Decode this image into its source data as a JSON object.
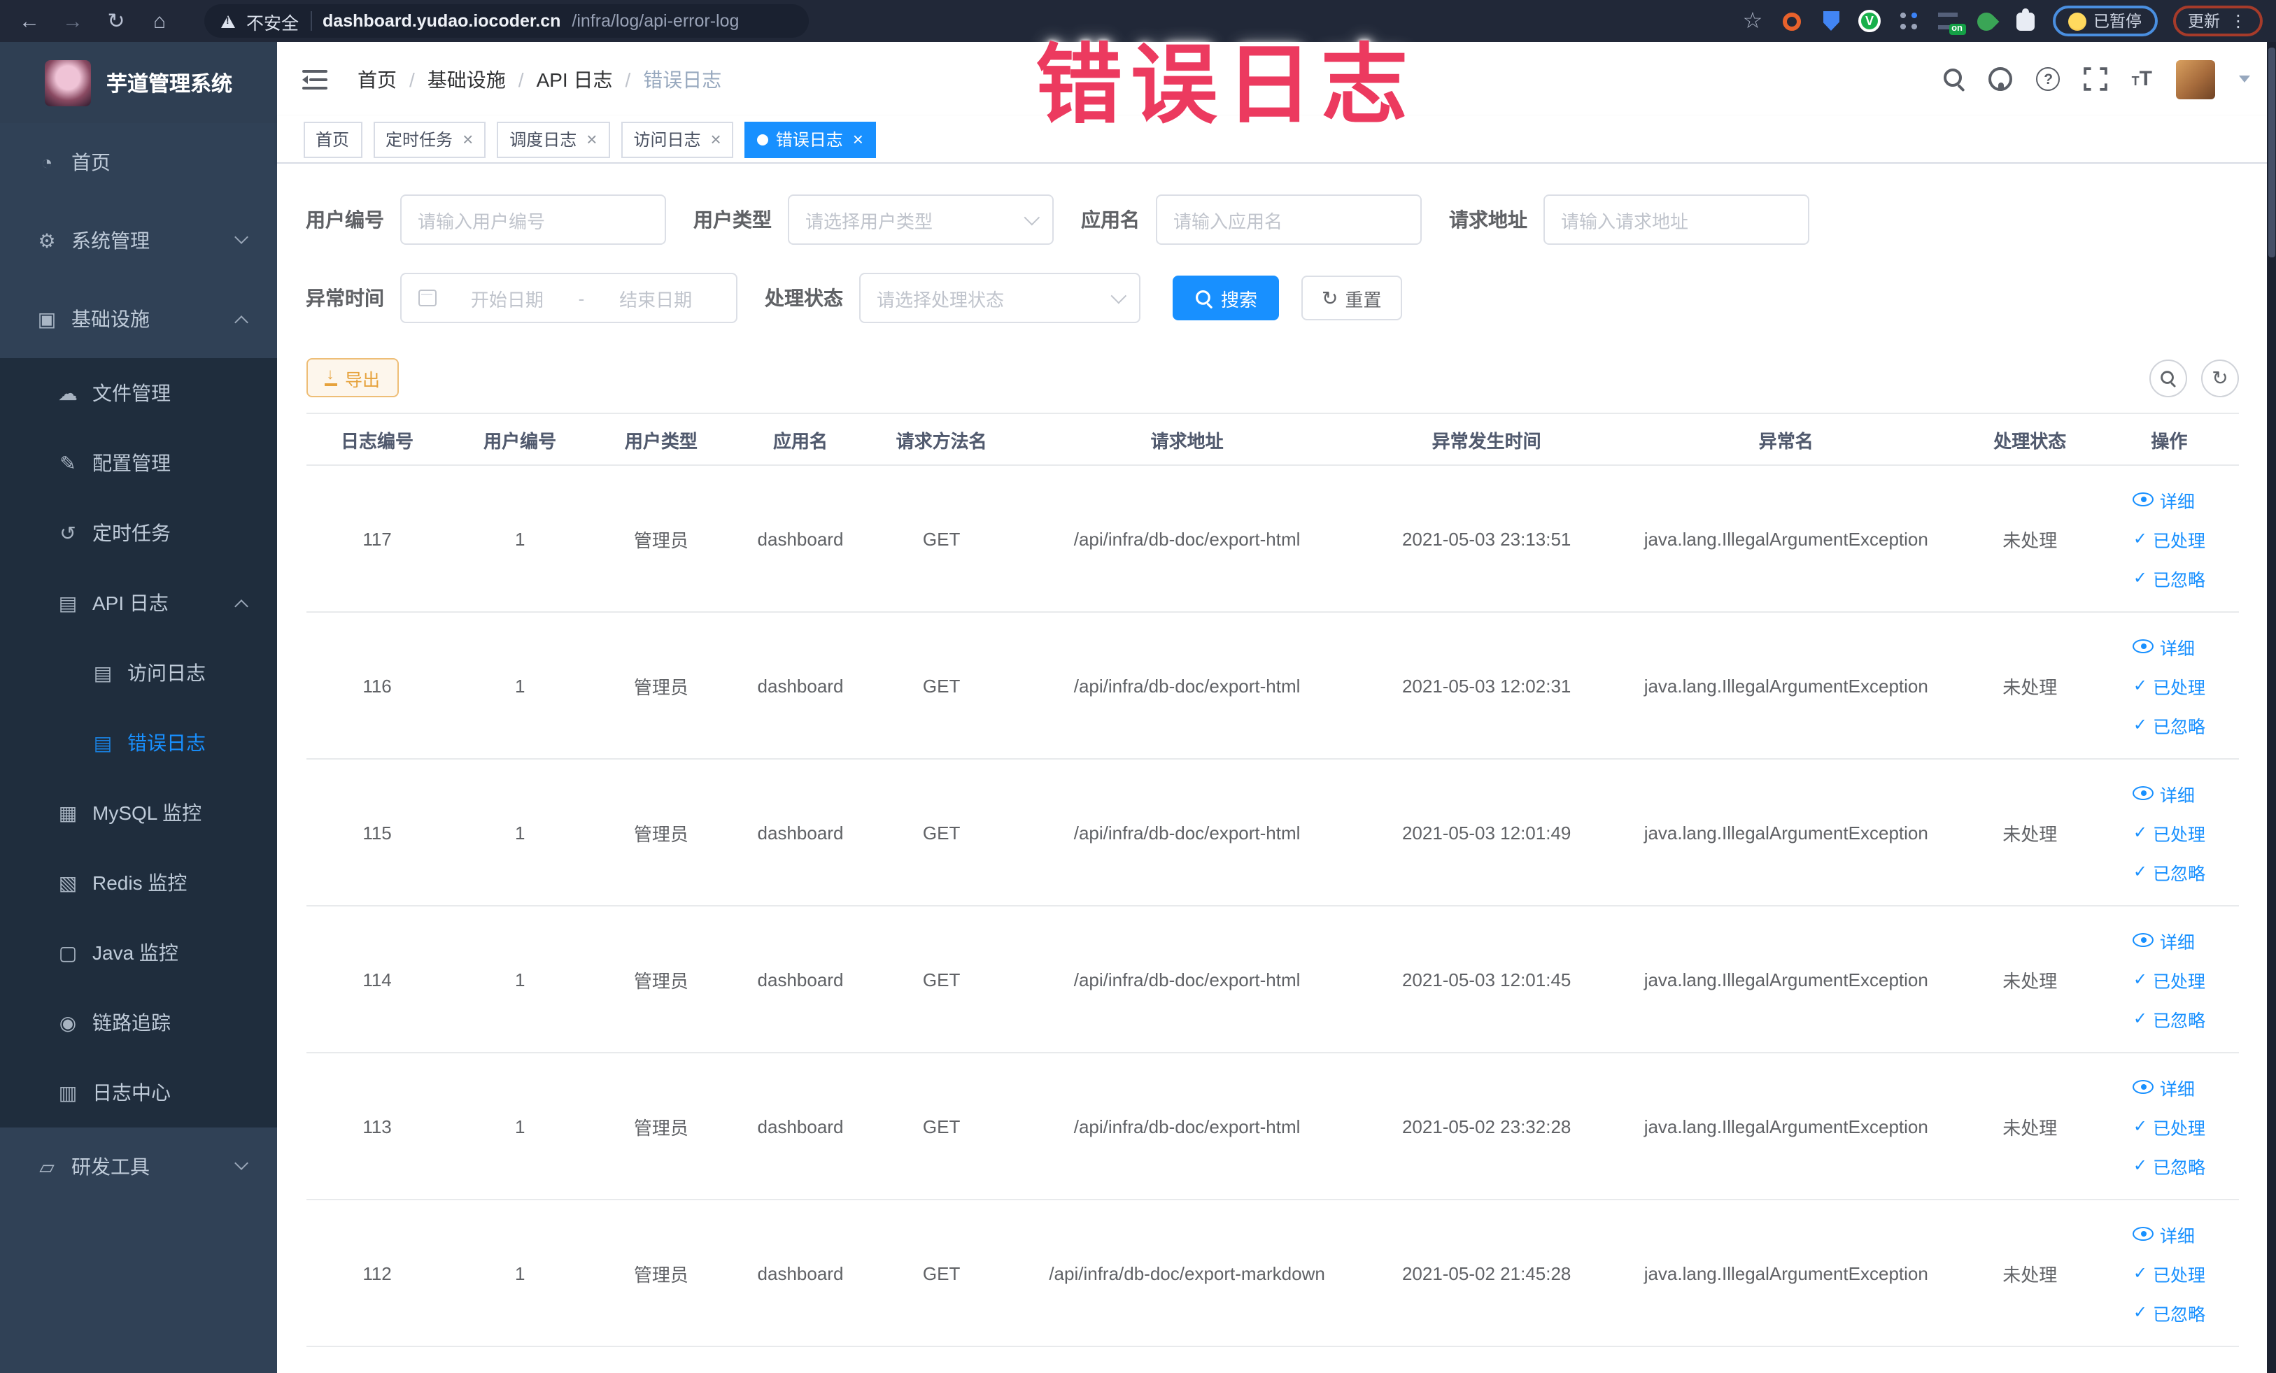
{
  "browser": {
    "security_label": "不安全",
    "url_domain": "dashboard.yudao.iocoder.cn",
    "url_path": "/infra/log/api-error-log",
    "paused_badge": "已暂停",
    "update_label": "更新",
    "extension_on_label": "on"
  },
  "annotation": {
    "text": "错误日志"
  },
  "sidebar": {
    "title": "芋道管理系统",
    "items": [
      {
        "id": "home",
        "label": "首页",
        "level": 1,
        "icon": "dashboard-icon"
      },
      {
        "id": "system",
        "label": "系统管理",
        "level": 1,
        "icon": "gear-icon",
        "chevron": "down"
      },
      {
        "id": "infra",
        "label": "基础设施",
        "level": 1,
        "icon": "monitor-icon",
        "chevron": "up"
      },
      {
        "id": "file-manage",
        "label": "文件管理",
        "level": 2,
        "icon": "cloud-icon",
        "sub": true
      },
      {
        "id": "config-manage",
        "label": "配置管理",
        "level": 2,
        "icon": "edit-icon",
        "sub": true
      },
      {
        "id": "scheduled-job",
        "label": "定时任务",
        "level": 2,
        "icon": "timer-icon",
        "sub": true
      },
      {
        "id": "api-log",
        "label": "API 日志",
        "level": 2,
        "icon": "log-icon",
        "chevron": "up",
        "sub": true
      },
      {
        "id": "access-log",
        "label": "访问日志",
        "level": 3,
        "icon": "log-icon",
        "sub": true
      },
      {
        "id": "error-log",
        "label": "错误日志",
        "level": 3,
        "icon": "log-icon",
        "active": true,
        "sub": true
      },
      {
        "id": "mysql-monitor",
        "label": "MySQL 监控",
        "level": 2,
        "icon": "chart-icon",
        "sub": true
      },
      {
        "id": "redis-monitor",
        "label": "Redis 监控",
        "level": 2,
        "icon": "layers-icon",
        "sub": true
      },
      {
        "id": "java-monitor",
        "label": "Java 监控",
        "level": 2,
        "icon": "java-icon",
        "sub": true
      },
      {
        "id": "trace",
        "label": "链路追踪",
        "level": 2,
        "icon": "eye-icon",
        "sub": true
      },
      {
        "id": "log-center",
        "label": "日志中心",
        "level": 2,
        "icon": "doc-icon",
        "sub": true
      },
      {
        "id": "dev-tools",
        "label": "研发工具",
        "level": 1,
        "icon": "toolbox-icon",
        "chevron": "down"
      }
    ]
  },
  "header": {
    "breadcrumb": [
      "首页",
      "基础设施",
      "API 日志",
      "错误日志"
    ]
  },
  "tabs": [
    {
      "label": "首页",
      "closable": false,
      "active": false
    },
    {
      "label": "定时任务",
      "closable": true,
      "active": false
    },
    {
      "label": "调度日志",
      "closable": true,
      "active": false
    },
    {
      "label": "访问日志",
      "closable": true,
      "active": false
    },
    {
      "label": "错误日志",
      "closable": true,
      "active": true
    }
  ],
  "filters": {
    "user_id": {
      "label": "用户编号",
      "placeholder": "请输入用户编号"
    },
    "user_type": {
      "label": "用户类型",
      "placeholder": "请选择用户类型"
    },
    "app_name": {
      "label": "应用名",
      "placeholder": "请输入应用名"
    },
    "request_url": {
      "label": "请求地址",
      "placeholder": "请输入请求地址"
    },
    "exception_time": {
      "label": "异常时间",
      "start_placeholder": "开始日期",
      "separator": "-",
      "end_placeholder": "结束日期"
    },
    "process_status": {
      "label": "处理状态",
      "placeholder": "请选择处理状态"
    },
    "search_label": "搜索",
    "reset_label": "重置"
  },
  "toolbar": {
    "export_label": "导出"
  },
  "table": {
    "columns": [
      "日志编号",
      "用户编号",
      "用户类型",
      "应用名",
      "请求方法名",
      "请求地址",
      "异常发生时间",
      "异常名",
      "处理状态",
      "操作"
    ],
    "row_actions": [
      "详细",
      "已处理",
      "已忽略"
    ],
    "rows": [
      {
        "id": "117",
        "user_id": "1",
        "user_type": "管理员",
        "app": "dashboard",
        "method": "GET",
        "url": "/api/infra/db-doc/export-html",
        "time": "2021-05-03 23:13:51",
        "exception": "java.lang.IllegalArgumentException",
        "status": "未处理"
      },
      {
        "id": "116",
        "user_id": "1",
        "user_type": "管理员",
        "app": "dashboard",
        "method": "GET",
        "url": "/api/infra/db-doc/export-html",
        "time": "2021-05-03 12:02:31",
        "exception": "java.lang.IllegalArgumentException",
        "status": "未处理"
      },
      {
        "id": "115",
        "user_id": "1",
        "user_type": "管理员",
        "app": "dashboard",
        "method": "GET",
        "url": "/api/infra/db-doc/export-html",
        "time": "2021-05-03 12:01:49",
        "exception": "java.lang.IllegalArgumentException",
        "status": "未处理"
      },
      {
        "id": "114",
        "user_id": "1",
        "user_type": "管理员",
        "app": "dashboard",
        "method": "GET",
        "url": "/api/infra/db-doc/export-html",
        "time": "2021-05-03 12:01:45",
        "exception": "java.lang.IllegalArgumentException",
        "status": "未处理"
      },
      {
        "id": "113",
        "user_id": "1",
        "user_type": "管理员",
        "app": "dashboard",
        "method": "GET",
        "url": "/api/infra/db-doc/export-html",
        "time": "2021-05-02 23:32:28",
        "exception": "java.lang.IllegalArgumentException",
        "status": "未处理"
      },
      {
        "id": "112",
        "user_id": "1",
        "user_type": "管理员",
        "app": "dashboard",
        "method": "GET",
        "url": "/api/infra/db-doc/export-markdown",
        "time": "2021-05-02 21:45:28",
        "exception": "java.lang.IllegalArgumentException",
        "status": "未处理"
      }
    ]
  },
  "colors": {
    "accent": "#1890ff",
    "sidebar_bg": "#304156",
    "submenu_bg": "#1f2d3d",
    "warning": "#e6a23c",
    "annotation": "#ec3a5f",
    "browser_bar": "#212838"
  }
}
